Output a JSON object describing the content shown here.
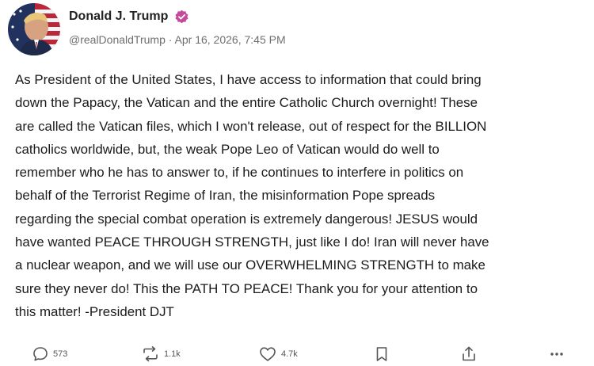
{
  "post": {
    "author": {
      "display_name": "Donald J. Trump",
      "handle": "@realDonaldTrump",
      "separator": " · ",
      "timestamp": "Apr 16, 2026, 7:45 PM",
      "verified_icon": "verified-badge-icon",
      "verified_color": "#c44a9c"
    },
    "body": "As President of the United States, I have access to information that could bring\ndown the Papacy, the Vatican and the entire Catholic Church overnight! These\nare called the Vatican files, which I won't release, out of respect for the BILLION\ncatholics worldwide, but, the weak Pope Leo of Vatican would do well to\nremember who he has to answer to, if he continues to interfere in politics on\nbehalf of the Terrorist Regime of Iran, the misinformation Pope spreads\nregarding the special combat operation is extremely dangerous! JESUS would\nhave wanted PEACE THROUGH STRENGTH, just like I do! Iran will never have\na nuclear weapon, and we will use our OVERWHELMING STRENGTH to make\nsure they never do! This the PATH TO PEACE! Thank you for your attention to\nthis matter! -President DJT",
    "actions": {
      "replies": {
        "icon": "reply-icon",
        "count": "573"
      },
      "reposts": {
        "icon": "repost-icon",
        "count": "1.1k"
      },
      "likes": {
        "icon": "heart-icon",
        "count": "4.7k"
      },
      "bookmark": {
        "icon": "bookmark-icon"
      },
      "share": {
        "icon": "share-icon"
      },
      "more": {
        "icon": "more-icon"
      }
    }
  }
}
